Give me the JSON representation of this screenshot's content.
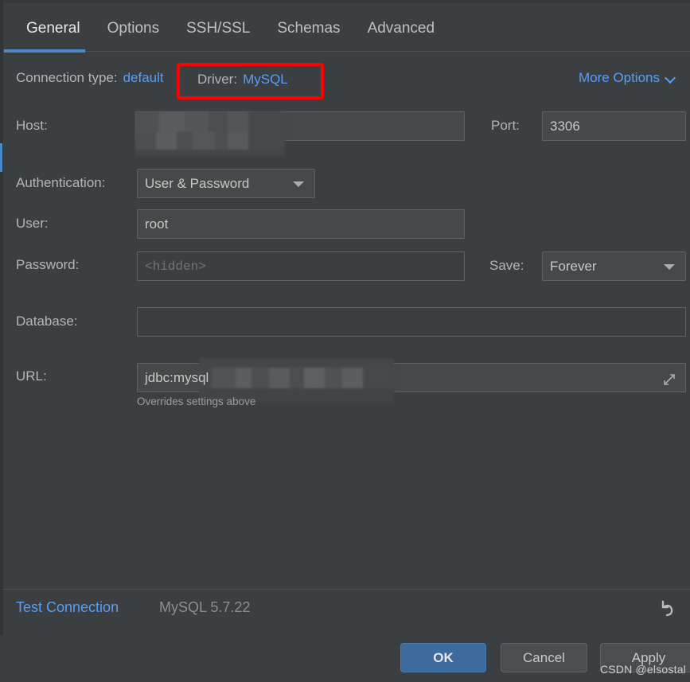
{
  "dialog": {
    "tabs": [
      {
        "label": "General",
        "active": true
      },
      {
        "label": "Options",
        "active": false
      },
      {
        "label": "SSH/SSL",
        "active": false
      },
      {
        "label": "Schemas",
        "active": false
      },
      {
        "label": "Advanced",
        "active": false
      }
    ],
    "connection_type": {
      "label": "Connection type:",
      "value": "default"
    },
    "driver": {
      "label": "Driver:",
      "value": "MySQL",
      "highlight_color": "#fe0000"
    },
    "more_options": {
      "label": "More Options",
      "icon": "chevron-down-icon"
    },
    "fields": {
      "host": {
        "label": "Host:",
        "value": "",
        "redacted": true
      },
      "port": {
        "label": "Port:",
        "value": "3306"
      },
      "authentication": {
        "label": "Authentication:",
        "value": "User & Password",
        "icon": "chevron-down-icon"
      },
      "user": {
        "label": "User:",
        "value": "root"
      },
      "password": {
        "label": "Password:",
        "value": "",
        "placeholder": "<hidden>"
      },
      "save": {
        "label": "Save:",
        "value": "Forever",
        "icon": "chevron-down-icon"
      },
      "database": {
        "label": "Database:",
        "value": ""
      },
      "url": {
        "label": "URL:",
        "value": "jdbc:mysql",
        "redacted": true,
        "hint": "Overrides settings above",
        "expand_icon": "expand-diagonal-icon"
      }
    },
    "status_bar": {
      "test_connection": "Test Connection",
      "db_version": "MySQL 5.7.22",
      "revert_icon": "revert-arrow-icon"
    },
    "footer": {
      "ok": "OK",
      "cancel": "Cancel",
      "apply": "Apply"
    },
    "watermark": "CSDN @elsostal",
    "colors": {
      "background": "#3c3f41",
      "field_background": "#45494a",
      "accent_blue": "#4a88c7",
      "link_blue": "#589df6",
      "highlight_red": "#fe0000",
      "ok_button": "#3e6b9e"
    }
  }
}
